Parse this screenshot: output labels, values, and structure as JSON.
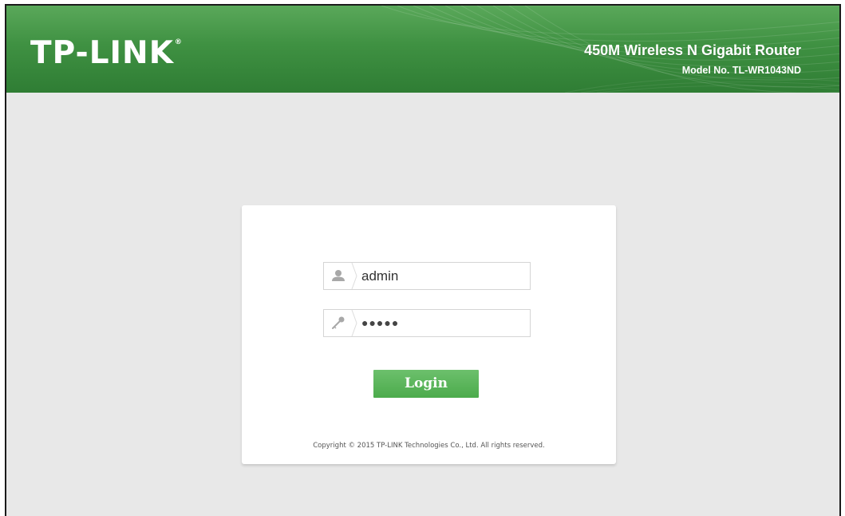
{
  "header": {
    "brand": "TP-LINK",
    "brand_mark": "®",
    "product_name": "450M Wireless N Gigabit Router",
    "model_no": "Model No. TL-WR1043ND"
  },
  "login": {
    "username_value": "admin",
    "username_icon": "user-icon",
    "password_value": "●●●●●",
    "password_icon": "key-icon",
    "button_label": "Login"
  },
  "footer": {
    "copyright": "Copyright © 2015 TP-LINK Technologies Co., Ltd. All rights reserved."
  },
  "colors": {
    "header_green": "#3f9142",
    "button_green": "#5cb85c",
    "background": "#e8e8e8"
  }
}
